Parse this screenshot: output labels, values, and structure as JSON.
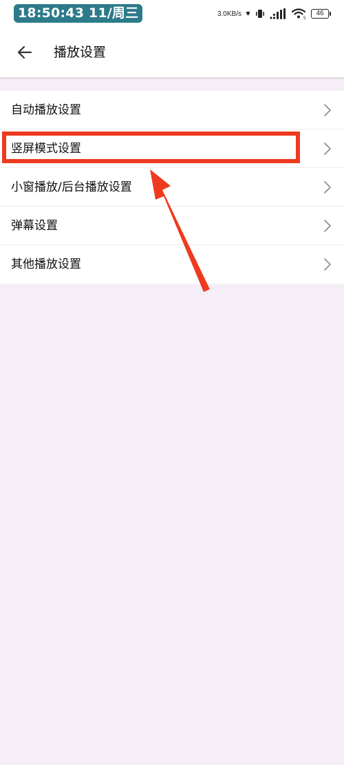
{
  "status_bar": {
    "time": "18:50:43 11/周三",
    "net_speed": "3.0KB/s",
    "battery": "46"
  },
  "header": {
    "title": "播放设置"
  },
  "settings": {
    "items": [
      {
        "label": "自动播放设置"
      },
      {
        "label": "竖屏模式设置"
      },
      {
        "label": "小窗播放/后台播放设置"
      },
      {
        "label": "弹幕设置"
      },
      {
        "label": "其他播放设置"
      }
    ]
  },
  "colors": {
    "accent_annotation": "#ee3a1f",
    "time_pill": "#2c7a8a",
    "page_background": "#f6eef6"
  },
  "icons": {
    "back": "arrow-left-icon",
    "item_chevron": "chevron-right-icon"
  }
}
